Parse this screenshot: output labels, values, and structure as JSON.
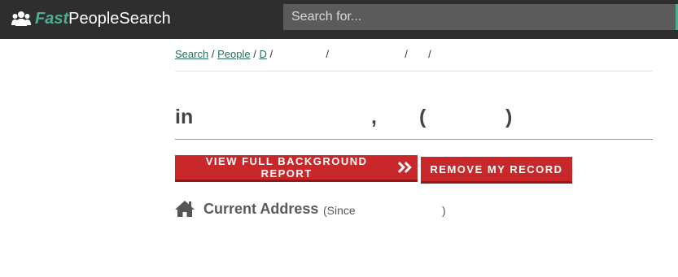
{
  "header": {
    "brand_fast": "Fast",
    "brand_rest": "PeopleSearch",
    "search_placeholder": "Search for...",
    "colors": {
      "bar": "#2e2e2e",
      "accent": "#4caf93"
    }
  },
  "breadcrumb": {
    "items": [
      "Search",
      "People",
      "D"
    ],
    "separator": "/"
  },
  "heading": {
    "prefix": "in",
    "comma": ",",
    "open_paren": "(",
    "close_paren": ")"
  },
  "buttons": {
    "report_label": "VIEW FULL BACKGROUND REPORT",
    "remove_label": "REMOVE MY RECORD",
    "color": "#c8282a"
  },
  "address": {
    "title": "Current Address",
    "since": "(Since",
    "close_paren": ")",
    "icon": "home-icon"
  }
}
